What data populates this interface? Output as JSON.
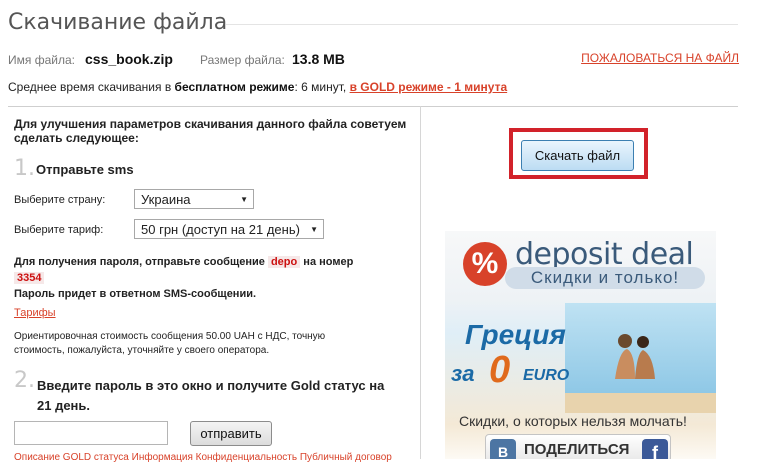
{
  "header": {
    "title": "Скачивание файла",
    "file_name_label": "Имя файла:",
    "file_name": "css_book.zip",
    "file_size_label": "Размер файла:",
    "file_size": "13.8 MB",
    "report_link": "ПОЖАЛОВАТЬСЯ НА ФАЙЛ"
  },
  "avg_time": {
    "prefix": "Среднее время скачивания в",
    "free_mode": "бесплатном режиме",
    "free_time": ": 6 минут,",
    "gold_link": "в GOLD режиме - 1 минута"
  },
  "left": {
    "intro": "Для улучшения параметров скачивания данного файла советуем сделать следующее:",
    "step1_num": "1.",
    "step1_text": "Отправьте sms",
    "country_label": "Выберите страну:",
    "country_value": "Украина",
    "tariff_label": "Выберите тариф:",
    "tariff_value": "50 грн (доступ на 21 день)",
    "password_msg_prefix": "Для получения пароля, отправьте сообщение",
    "sms_code": "depo",
    "password_msg_suffix": "на номер",
    "sms_number": "3354",
    "password_reply": "Пароль придет в ответном SMS-сообщении.",
    "tariffs_link": "Тарифы",
    "cost_note": "Ориентировочная стоимость сообщения 50.00 UAH с НДС, точную стоимость, пожалуйста, уточняйте у своего оператора.",
    "step2_num": "2.",
    "step2_text": "Введите пароль в это окно и получите Gold статус на 21 день.",
    "password_placeholder": "",
    "send_button": "отправить",
    "bottom_cut_text": "Описание GOLD статуса   Информация   Конфиденциальность   Публичный договор"
  },
  "right": {
    "download_button": "Скачать файл",
    "ad": {
      "brand_symbol": "%",
      "brand": "deposit deal",
      "brand_slogan": "Скидки и только!",
      "destination": "Греция",
      "price_prefix": "за",
      "price_value": "0",
      "price_currency": "EURO",
      "tagline": "Скидки, о которых нельзя молчать!",
      "vk_letter": "В",
      "share_label": "ПОДЕЛИТЬСЯ",
      "fb_letter": "f"
    }
  },
  "colors": {
    "link_red": "#d8422a",
    "highlight_frame": "#d2222a",
    "download_button_border": "#3c7fb1"
  }
}
